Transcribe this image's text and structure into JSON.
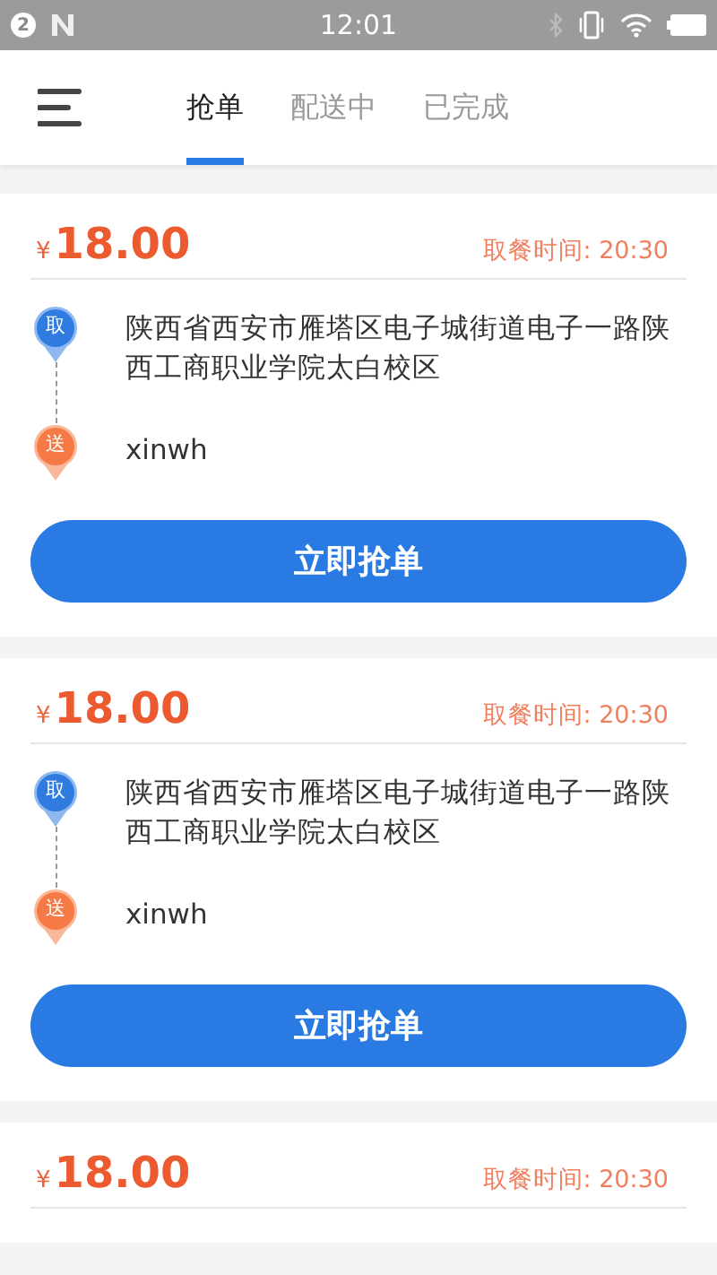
{
  "status_bar": {
    "notification_count": "2",
    "time": "12:01"
  },
  "tabs": [
    {
      "label": "抢单",
      "selected": true
    },
    {
      "label": "配送中",
      "selected": false
    },
    {
      "label": "已完成",
      "selected": false
    }
  ],
  "orders": [
    {
      "currency": "¥",
      "price": "18.00",
      "pickup_time": "取餐时间: 20:30",
      "stops": [
        {
          "kind": "pickup",
          "marker": "取",
          "text": "陕西省西安市雁塔区电子城街道电子一路陕西工商职业学院太白校区"
        },
        {
          "kind": "delivery",
          "marker": "送",
          "text": "xinwh"
        }
      ],
      "button": "立即抢单"
    },
    {
      "currency": "¥",
      "price": "18.00",
      "pickup_time": "取餐时间: 20:30",
      "stops": [
        {
          "kind": "pickup",
          "marker": "取",
          "text": "陕西省西安市雁塔区电子城街道电子一路陕西工商职业学院太白校区"
        },
        {
          "kind": "delivery",
          "marker": "送",
          "text": "xinwh"
        }
      ],
      "button": "立即抢单"
    },
    {
      "currency": "¥",
      "price": "18.00",
      "pickup_time": "取餐时间: 20:30"
    }
  ]
}
